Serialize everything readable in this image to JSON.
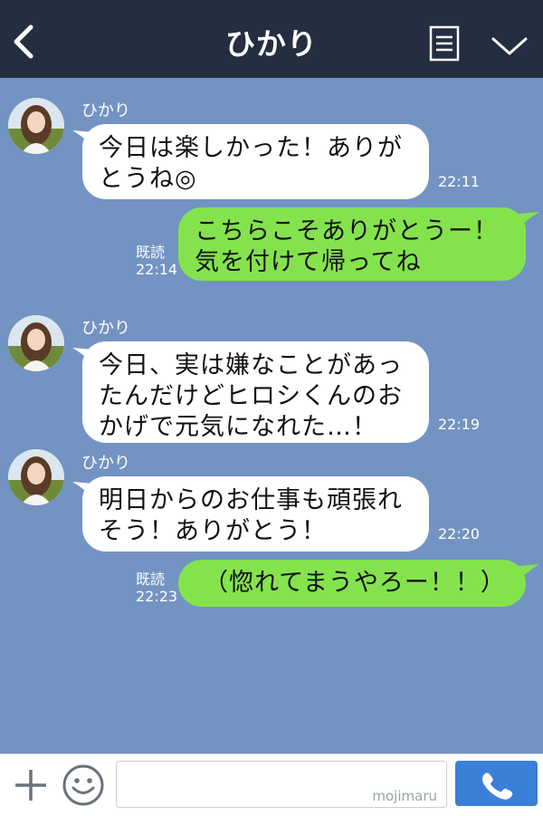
{
  "header": {
    "title": "ひかり",
    "back_icon": "chevron-left-icon",
    "notes_icon": "notes-icon",
    "menu_icon": "chevron-down-icon"
  },
  "messages": [
    {
      "sender": "ひかり",
      "lines": [
        "今日は楽しかった！ありが",
        "とうね◎"
      ],
      "time": "22:11"
    },
    {
      "sender": "me",
      "lines": [
        "こちらこそありがとうー！",
        "気を付けて帰ってね"
      ],
      "read": "既読",
      "time": "22:14"
    },
    {
      "sender": "ひかり",
      "lines": [
        "今日、実は嫌なことがあっ",
        "たんだけどヒロシくんのお",
        "かげで元気になれた…！"
      ],
      "time": "22:19"
    },
    {
      "sender": "ひかり",
      "lines": [
        "明日からのお仕事も頑張れ",
        "そう！ありがとう！"
      ],
      "time": "22:20"
    },
    {
      "sender": "me",
      "lines": [
        "（惚れてまうやろー！！）"
      ],
      "read": "既読",
      "time": "22:23"
    }
  ],
  "footer": {
    "plus_icon": "plus-icon",
    "emoji_icon": "smiley-icon",
    "input_placeholder": "",
    "watermark": "mojimaru",
    "call_icon": "phone-icon"
  },
  "colors": {
    "header_bg": "#252d40",
    "chat_bg": "#7393c3",
    "incoming_bubble": "#ffffff",
    "outgoing_bubble": "#84e34d",
    "call_button": "#3a7fd8"
  }
}
